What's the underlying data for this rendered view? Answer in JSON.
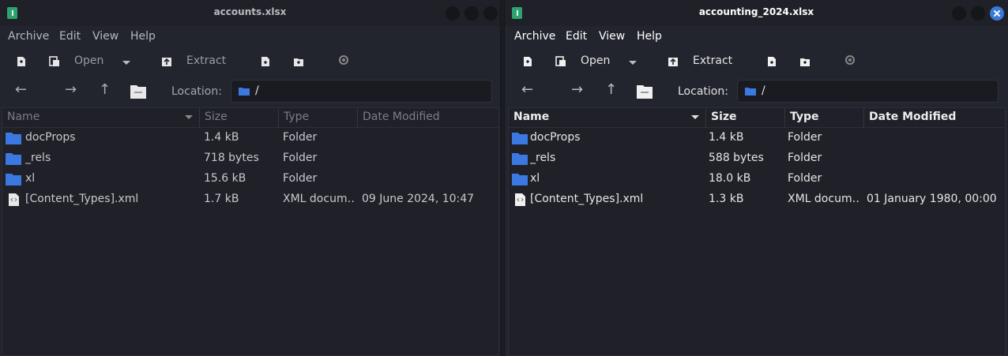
{
  "colors": {
    "window_bg": "#23252e",
    "titlebar_bg": "#1f2028",
    "accent": "#3b79d8",
    "folder": "#3b79e0",
    "app_icon": "#2ea36f"
  },
  "windows": [
    {
      "id": "left",
      "active": false,
      "title": "accounts.xlsx",
      "menu": [
        "Archive",
        "Edit",
        "View",
        "Help"
      ],
      "toolbar": {
        "open_label": "Open",
        "extract_label": "Extract"
      },
      "location": {
        "label": "Location:",
        "value": "/"
      },
      "columns": [
        "Name",
        "Size",
        "Type",
        "Date Modified"
      ],
      "rows": [
        {
          "name": "docProps",
          "size": "1.4 kB",
          "type": "Folder",
          "date": "",
          "icon": "folder-icon"
        },
        {
          "name": "_rels",
          "size": "718 bytes",
          "type": "Folder",
          "date": "",
          "icon": "folder-icon"
        },
        {
          "name": "xl",
          "size": "15.6 kB",
          "type": "Folder",
          "date": "",
          "icon": "folder-icon"
        },
        {
          "name": "[Content_Types].xml",
          "size": "1.7 kB",
          "type": "XML docum…",
          "date": "09 June 2024, 10:47",
          "icon": "xml-file-icon"
        }
      ]
    },
    {
      "id": "right",
      "active": true,
      "title": "accounting_2024.xlsx",
      "menu": [
        "Archive",
        "Edit",
        "View",
        "Help"
      ],
      "toolbar": {
        "open_label": "Open",
        "extract_label": "Extract"
      },
      "location": {
        "label": "Location:",
        "value": "/"
      },
      "columns": [
        "Name",
        "Size",
        "Type",
        "Date Modified"
      ],
      "rows": [
        {
          "name": "docProps",
          "size": "1.4 kB",
          "type": "Folder",
          "date": "",
          "icon": "folder-icon"
        },
        {
          "name": "_rels",
          "size": "588 bytes",
          "type": "Folder",
          "date": "",
          "icon": "folder-icon"
        },
        {
          "name": "xl",
          "size": "18.0 kB",
          "type": "Folder",
          "date": "",
          "icon": "folder-icon"
        },
        {
          "name": "[Content_Types].xml",
          "size": "1.3 kB",
          "type": "XML docum…",
          "date": "01 January 1980, 00:00",
          "icon": "xml-file-icon"
        }
      ]
    }
  ]
}
